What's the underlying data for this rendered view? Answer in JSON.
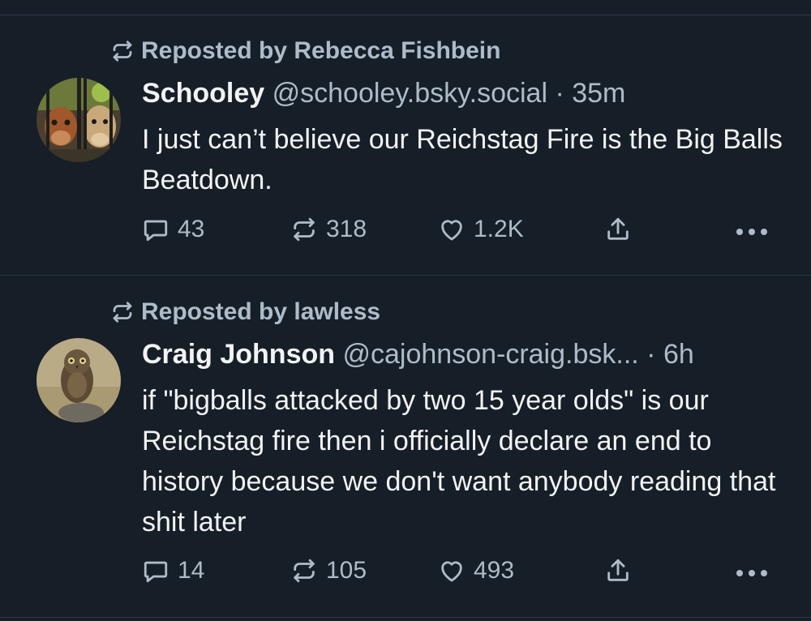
{
  "posts": [
    {
      "repost_label": "Reposted by Rebecca Fishbein",
      "author": {
        "display_name": "Schooley",
        "handle": "@schooley.bsky.social",
        "time": "· 35m"
      },
      "text": "I just can’t believe our Reichstag Fire is the Big Balls Beatdown.",
      "counts": {
        "replies": "43",
        "reposts": "318",
        "likes": "1.2K"
      }
    },
    {
      "repost_label": "Reposted by lawless",
      "author": {
        "display_name": "Craig Johnson",
        "handle": "@cajohnson-craig.bsk...",
        "time": "· 6h"
      },
      "text": "if \"bigballs attacked by two 15 year olds\" is our Reichstag fire then i officially declare an end to history because we don't want anybody reading that shit later",
      "counts": {
        "replies": "14",
        "reposts": "105",
        "likes": "493"
      }
    }
  ],
  "colors": {
    "background": "#161e27",
    "text_primary": "#f1f3f5",
    "text_secondary": "#aebbc9",
    "divider": "#2e3843"
  },
  "icons": {
    "repost_indicator": "repost-icon",
    "reply": "reply-icon",
    "repost": "repost-icon",
    "like": "heart-icon",
    "share": "share-icon",
    "more": "more-icon"
  }
}
